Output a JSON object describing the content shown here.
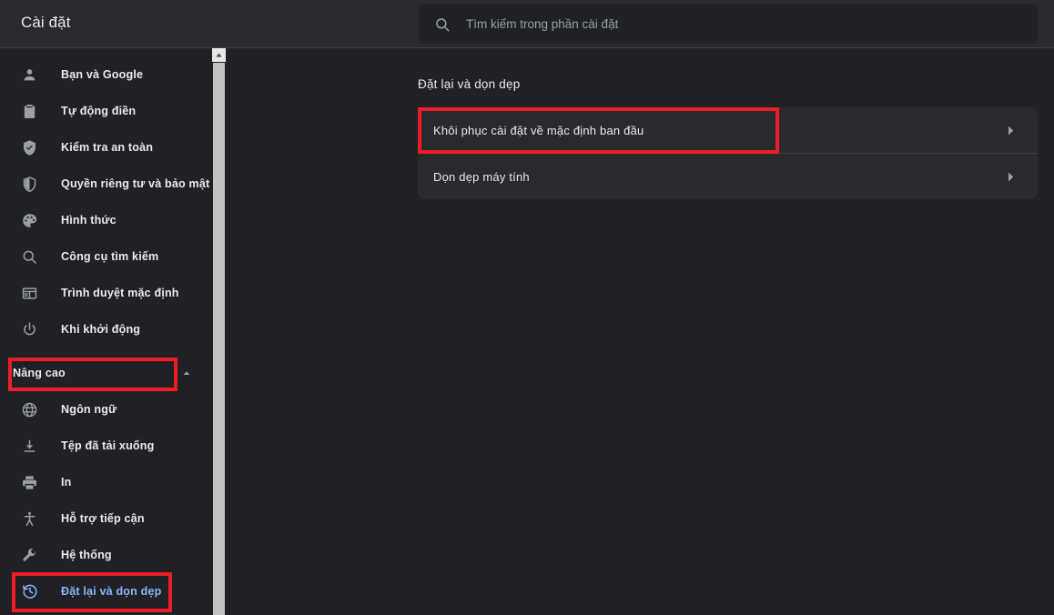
{
  "header": {
    "title": "Cài đặt",
    "search": {
      "placeholder": "Tìm kiếm trong phần cài đặt",
      "value": "",
      "icon": "search-icon"
    }
  },
  "sidebar": {
    "items": [
      {
        "label": "Bạn và Google",
        "icon": "person-icon"
      },
      {
        "label": "Tự động điền",
        "icon": "clipboard-icon"
      },
      {
        "label": "Kiểm tra an toàn",
        "icon": "shield-check-icon"
      },
      {
        "label": "Quyền riêng tư và bảo mật",
        "icon": "shield-half-icon"
      },
      {
        "label": "Hình thức",
        "icon": "palette-icon"
      },
      {
        "label": "Công cụ tìm kiếm",
        "icon": "search-icon"
      },
      {
        "label": "Trình duyệt mặc định",
        "icon": "browser-window-icon"
      },
      {
        "label": "Khi khởi động",
        "icon": "power-icon"
      }
    ],
    "advanced": {
      "label": "Nâng cao",
      "caret_icon": "chevron-up-icon",
      "expanded": true,
      "items": [
        {
          "label": "Ngôn ngữ",
          "icon": "globe-icon"
        },
        {
          "label": "Tệp đã tải xuống",
          "icon": "download-icon"
        },
        {
          "label": "In",
          "icon": "printer-icon"
        },
        {
          "label": "Hỗ trợ tiếp cận",
          "icon": "accessibility-icon"
        },
        {
          "label": "Hệ thống",
          "icon": "wrench-icon"
        },
        {
          "label": "Đặt lại và dọn dẹp",
          "icon": "restore-history-icon",
          "selected": true
        }
      ]
    },
    "scrollbar": {
      "up_arrow_icon": "scroll-up-arrow-icon"
    }
  },
  "main": {
    "section_title": "Đặt lại và dọn dẹp",
    "rows": [
      {
        "label": "Khôi phục cài đặt về mặc định ban đầu",
        "arrow_icon": "chevron-right-icon"
      },
      {
        "label": "Dọn dẹp máy tính",
        "arrow_icon": "chevron-right-icon"
      }
    ]
  },
  "annotations": {
    "highlight_color": "#ee1c25",
    "boxes": [
      {
        "name": "highlight-advanced-section"
      },
      {
        "name": "highlight-reset-and-cleanup-item"
      },
      {
        "name": "highlight-restore-defaults-row"
      }
    ]
  },
  "theme": {
    "background": "#202124",
    "surface": "#292a2d",
    "accent_blue": "#8ab4f8",
    "text_primary": "#e8eaed",
    "text_secondary": "#9aa0a6",
    "divider": "#3c4043"
  }
}
